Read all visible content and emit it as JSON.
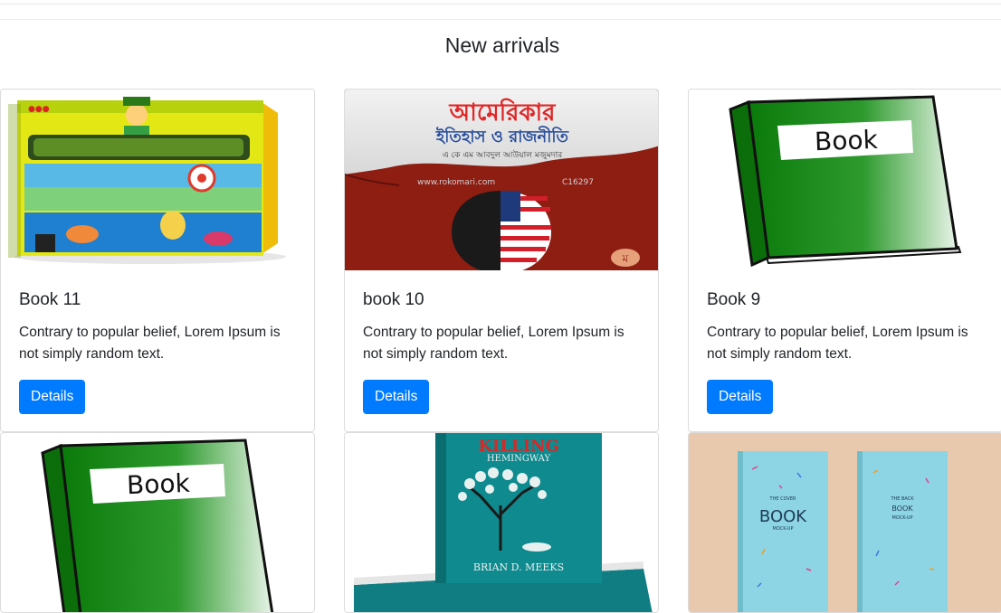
{
  "section": {
    "title": "New arrivals"
  },
  "cards": [
    {
      "title": "Book 11",
      "text": "Contrary to popular belief, Lorem Ipsum is not simply random text.",
      "button": "Details"
    },
    {
      "title": "book 10",
      "text": "Contrary to popular belief, Lorem Ipsum is not simply random text.",
      "button": "Details",
      "cover_title": "আমেরিকার",
      "cover_subtitle": "ইতিহাস ও রাজনীতি",
      "cover_author": "এ কে এম আবদুল আউয়াল মজুমদার",
      "cover_url": "www.rokomari.com",
      "cover_code": "C16297"
    },
    {
      "title": "Book 9",
      "text": "Contrary to popular belief, Lorem Ipsum is not simply random text.",
      "button": "Details",
      "cover_label": "Book"
    },
    {
      "cover_label": "Book"
    },
    {
      "cover_title": "KILLING",
      "cover_subtitle": "HEMINGWAY",
      "cover_author": "BRIAN D. MEEKS"
    },
    {
      "cover_small": "THE COVER",
      "cover_main": "BOOK",
      "cover_sub": "MOCK-UP",
      "back_small": "THE BACK",
      "back_main": "BOOK",
      "back_sub": "MOCK-UP"
    }
  ],
  "colors": {
    "primary": "#007bff",
    "text": "#212529",
    "border": "#dcdcdc"
  }
}
